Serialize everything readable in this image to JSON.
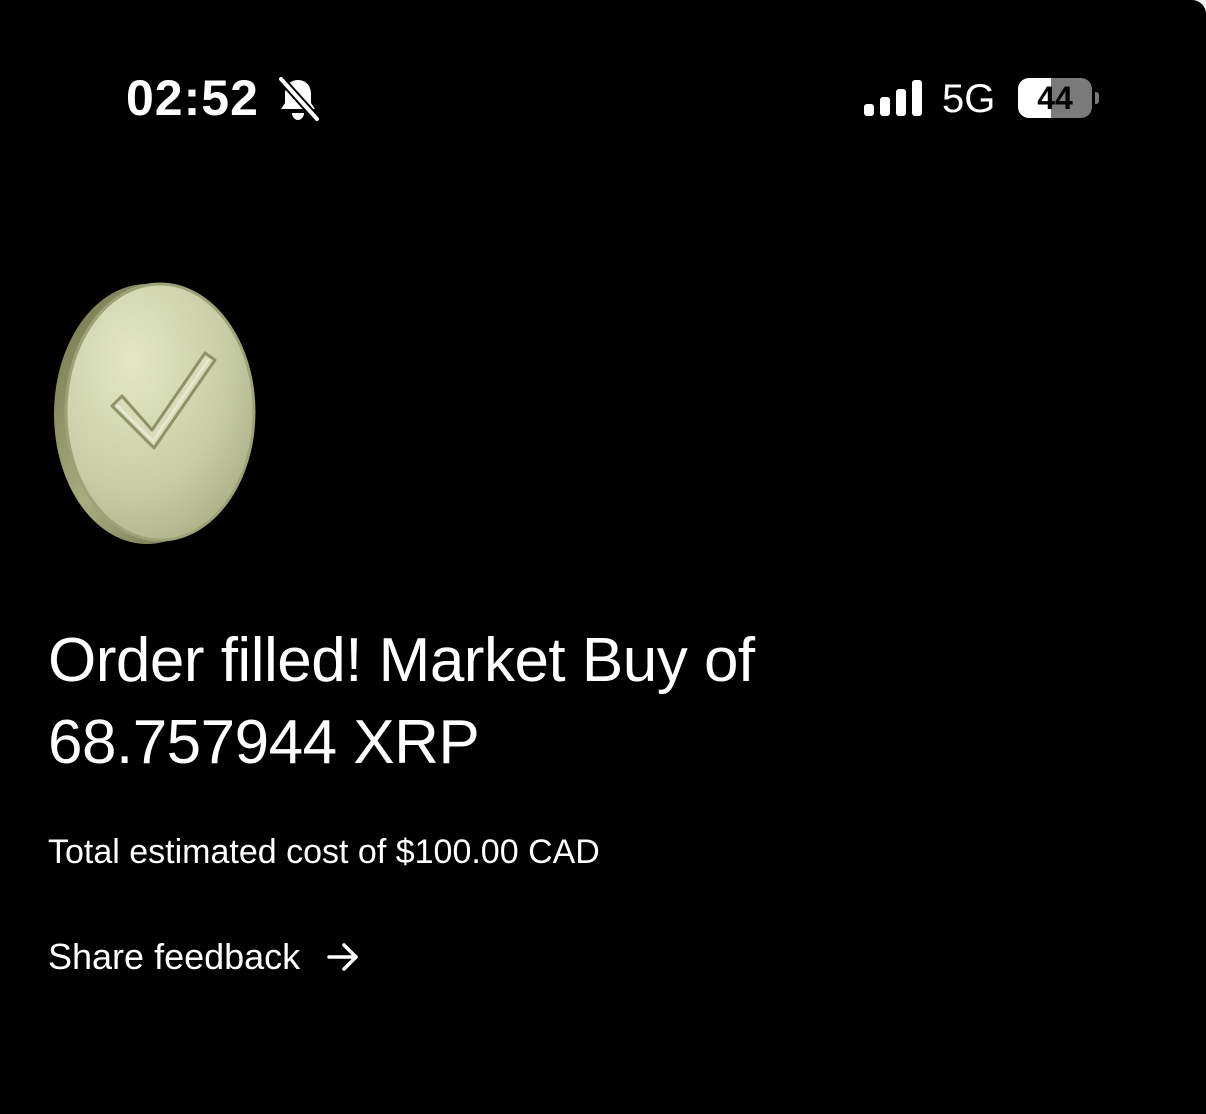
{
  "status_bar": {
    "time": "02:52",
    "network": "5G",
    "battery_level": "44",
    "battery_fraction": 0.44,
    "icons": {
      "silent": "bell-slash-icon",
      "signal": "cellular-signal-icon"
    }
  },
  "illustration": {
    "icon": "checkmark-coin-icon"
  },
  "confirmation": {
    "headline_line1": "Order filled! Market Buy of",
    "headline_line2": "68.757944 XRP",
    "cost_text": "Total estimated cost of $100.00 CAD"
  },
  "feedback": {
    "label": "Share feedback",
    "icon": "arrow-right-icon"
  },
  "colors": {
    "background": "#000000",
    "text": "#ffffff",
    "coin": "#c9ceaa"
  }
}
